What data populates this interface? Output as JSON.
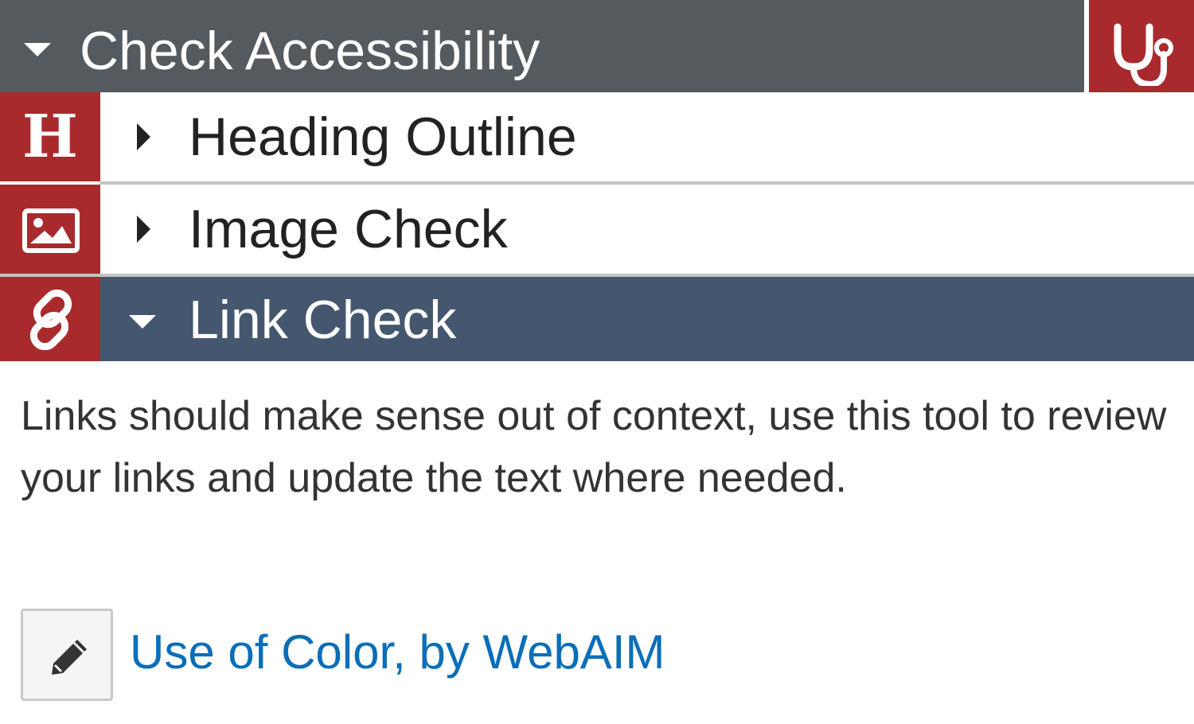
{
  "panel": {
    "title": "Check Accessibility",
    "title_icon": "caret-down-icon",
    "corner_icon": "stethoscope-icon"
  },
  "sections": [
    {
      "label": "Heading Outline",
      "badge_text": "H",
      "badge_icon": "heading-icon",
      "expanded": false
    },
    {
      "label": "Image Check",
      "badge_icon": "image-icon",
      "expanded": false
    },
    {
      "label": "Link Check",
      "badge_icon": "link-icon",
      "expanded": true
    }
  ],
  "link_check": {
    "description": "Links should make sense out of context, use this tool to review your links and update the text where needed.",
    "resource_link": "Use of Color, by WebAIM",
    "edit_icon": "pencil-icon"
  },
  "colors": {
    "header_bg": "#555a5e",
    "badge_red": "#a92a2d",
    "active_row_bg": "#44576e",
    "link_blue": "#0a6eb8"
  }
}
